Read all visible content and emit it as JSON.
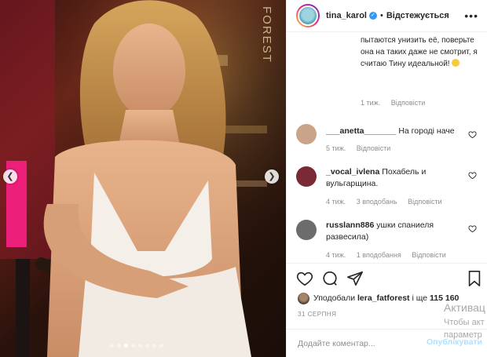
{
  "photo": {
    "brand_text": "FOREST",
    "prev_icon": "chevron-left-icon",
    "next_icon": "chevron-right-icon",
    "slide_count": 8,
    "active_slide": 2
  },
  "header": {
    "username": "tina_karol",
    "verified_glyph": "✓",
    "separator": "•",
    "follow_status": "Відстежується",
    "more_glyph": "•••"
  },
  "comments": {
    "continued": {
      "text": "пытаются унизить её, поверьте она на таких даже не смотрит, я считаю Тину идеальной!",
      "time": "1 тиж.",
      "reply": "Відповісти"
    },
    "items": [
      {
        "username": "___anetta_______",
        "text": "На городі наче",
        "time": "5 тиж.",
        "likes": "",
        "reply": "Відповісти",
        "avatar_color": "#c9a48a"
      },
      {
        "username": "_vocal_ivlena",
        "text": "Похабель и вульгарщина.",
        "time": "4 тиж.",
        "likes": "3 вподобань",
        "reply": "Відповісти",
        "avatar_color": "#7a2a35"
      },
      {
        "username": "russlann886",
        "text": "ушки спаниеля развесила)",
        "time": "4 тиж.",
        "likes": "1 вподобання",
        "reply": "Відповісти",
        "avatar_color": "#6c6c6c"
      }
    ]
  },
  "actions": {
    "like_icon": "heart-icon",
    "comment_icon": "comment-icon",
    "share_icon": "share-icon",
    "save_icon": "bookmark-icon"
  },
  "likes": {
    "prefix": "Уподобали",
    "user": "lera_fatforest",
    "middle": "і ще",
    "count": "115 160"
  },
  "date": "31 СЕРПНЯ",
  "add_comment": {
    "placeholder": "Додайте коментар...",
    "post_label": "Опублікувати"
  },
  "watermark": {
    "line1": "Активац",
    "line2": "Чтобы акт",
    "line3": "параметр"
  },
  "colors": {
    "accent_blue": "#3897f0",
    "post_disabled": "#b2dffc",
    "secondary_text": "#8e8e8e"
  }
}
